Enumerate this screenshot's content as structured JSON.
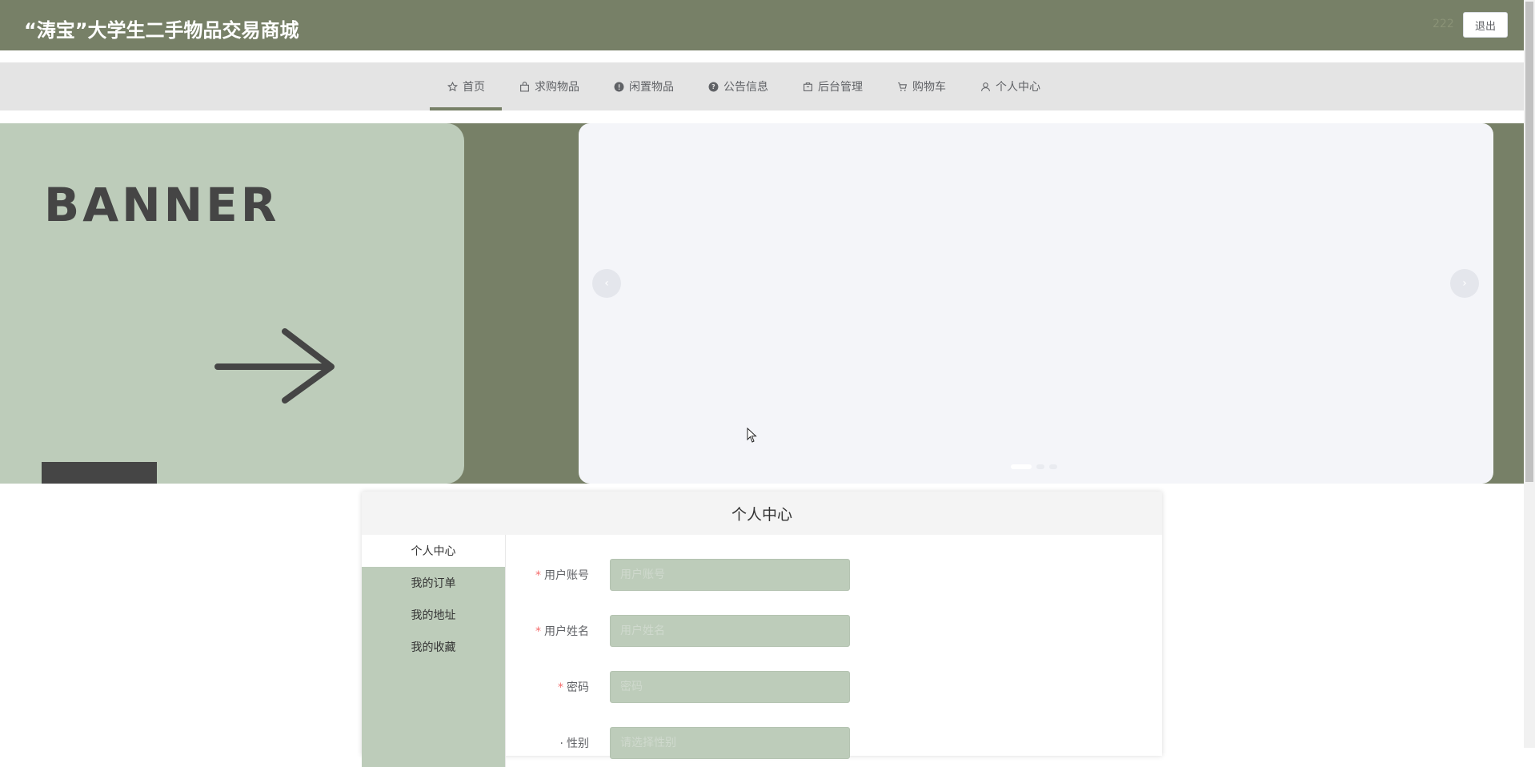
{
  "header": {
    "site_title": "“涛宝”大学生二手物品交易商城",
    "username": "222",
    "logout_label": "退出"
  },
  "nav": {
    "items": [
      {
        "label": "首页",
        "icon": "star-icon",
        "active": true
      },
      {
        "label": "求购物品",
        "icon": "bag-icon",
        "active": false
      },
      {
        "label": "闲置物品",
        "icon": "warning-circle-icon",
        "active": false
      },
      {
        "label": "公告信息",
        "icon": "question-circle-icon",
        "active": false
      },
      {
        "label": "后台管理",
        "icon": "box-icon",
        "active": false
      },
      {
        "label": "购物车",
        "icon": "cart-icon",
        "active": false
      },
      {
        "label": "个人中心",
        "icon": "user-icon",
        "active": false
      }
    ]
  },
  "banner": {
    "word": "BANNER",
    "prev_glyph": "‹",
    "next_glyph": "›"
  },
  "panel": {
    "title": "个人中心",
    "menu": [
      {
        "label": "个人中心",
        "active": true
      },
      {
        "label": "我的订单",
        "active": false
      },
      {
        "label": "我的地址",
        "active": false
      },
      {
        "label": "我的收藏",
        "active": false
      }
    ],
    "form": [
      {
        "label": "用户账号",
        "required": true,
        "placeholder": "用户账号"
      },
      {
        "label": "用户姓名",
        "required": true,
        "placeholder": "用户姓名"
      },
      {
        "label": "密码",
        "required": true,
        "placeholder": "密码"
      },
      {
        "label": "性别",
        "required": false,
        "placeholder": "请选择性别"
      }
    ]
  },
  "colors": {
    "brand": "#778067",
    "banner_light": "#bdccba",
    "nav_bg": "#e4e4e4"
  }
}
